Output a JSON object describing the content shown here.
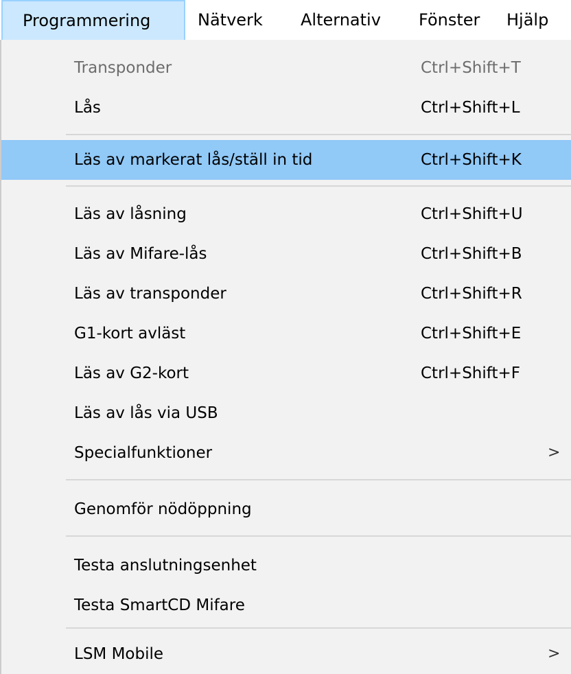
{
  "menubar": {
    "items": [
      {
        "label": "Programmering"
      },
      {
        "label": "Nätverk"
      },
      {
        "label": "Alternativ"
      },
      {
        "label": "Fönster"
      },
      {
        "label": "Hjälp"
      }
    ]
  },
  "menu": {
    "items": [
      {
        "label": "Transponder",
        "shortcut": "Ctrl+Shift+T"
      },
      {
        "label": "Lås",
        "shortcut": "Ctrl+Shift+L"
      },
      {
        "label": "Läs av markerat lås/ställ in tid",
        "shortcut": "Ctrl+Shift+K"
      },
      {
        "label": "Läs av låsning",
        "shortcut": "Ctrl+Shift+U"
      },
      {
        "label": "Läs av Mifare-lås",
        "shortcut": "Ctrl+Shift+B"
      },
      {
        "label": "Läs av transponder",
        "shortcut": "Ctrl+Shift+R"
      },
      {
        "label": "G1-kort avläst",
        "shortcut": "Ctrl+Shift+E"
      },
      {
        "label": "Läs av G2-kort",
        "shortcut": "Ctrl+Shift+F"
      },
      {
        "label": "Läs av lås via USB"
      },
      {
        "label": "Specialfunktioner",
        "submenu_arrow": ">"
      },
      {
        "label": "Genomför nödöppning"
      },
      {
        "label": "Testa anslutningsenhet"
      },
      {
        "label": "Testa SmartCD Mifare"
      },
      {
        "label": "LSM Mobile",
        "submenu_arrow": ">"
      }
    ]
  }
}
